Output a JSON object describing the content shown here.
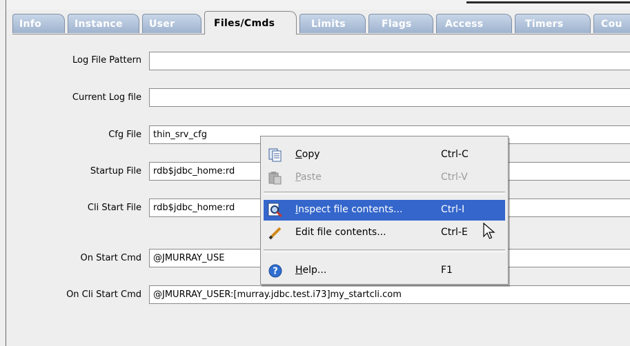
{
  "tabs": [
    {
      "label": "Info",
      "active": false
    },
    {
      "label": "Instance",
      "active": false
    },
    {
      "label": "User",
      "active": false
    },
    {
      "label": "Files/Cmds",
      "active": true
    },
    {
      "label": "Limits",
      "active": false
    },
    {
      "label": "Flags",
      "active": false
    },
    {
      "label": "Access",
      "active": false
    },
    {
      "label": "Timers",
      "active": false
    },
    {
      "label": "Cou",
      "active": false
    }
  ],
  "form": {
    "log_file_pattern": {
      "label": "Log File Pattern",
      "value": ""
    },
    "current_log_file": {
      "label": "Current Log file",
      "value": ""
    },
    "cfg_file": {
      "label": "Cfg File",
      "value": "thin_srv_cfg"
    },
    "startup_file": {
      "label": "Startup File",
      "value": "rdb$jdbc_home:rd"
    },
    "cli_start_file": {
      "label": "Cli Start File",
      "value": "rdb$jdbc_home:rd"
    },
    "on_start_cmd": {
      "label": "On Start Cmd",
      "value": "@JMURRAY_USE"
    },
    "on_cli_start_cmd": {
      "label": "On Cli Start Cmd",
      "value": "@JMURRAY_USER:[murray.jdbc.test.i73]my_startcli.com"
    }
  },
  "context_menu": {
    "items": [
      {
        "label": "Copy",
        "mnemonic": "C",
        "rest": "opy",
        "shortcut": "Ctrl-C",
        "icon": "copy-icon",
        "enabled": true,
        "selected": false
      },
      {
        "label": "Paste",
        "mnemonic": "P",
        "rest": "aste",
        "shortcut": "Ctrl-V",
        "icon": "paste-icon",
        "enabled": false,
        "selected": false
      },
      {
        "label": "Inspect file contents...",
        "mnemonic": "I",
        "rest": "nspect file contents...",
        "shortcut": "Ctrl-I",
        "icon": "magnifier-icon",
        "enabled": true,
        "selected": true
      },
      {
        "label": "Edit file contents...",
        "shortcut": "Ctrl-E",
        "icon": "pencil-icon",
        "enabled": true,
        "selected": false
      },
      {
        "label": "Help...",
        "mnemonic": "H",
        "rest": "elp...",
        "shortcut": "F1",
        "icon": "help-icon",
        "enabled": true,
        "selected": false
      }
    ]
  },
  "colors": {
    "selection": "#3466cc",
    "tab_inactive": "#9fb3cf"
  }
}
